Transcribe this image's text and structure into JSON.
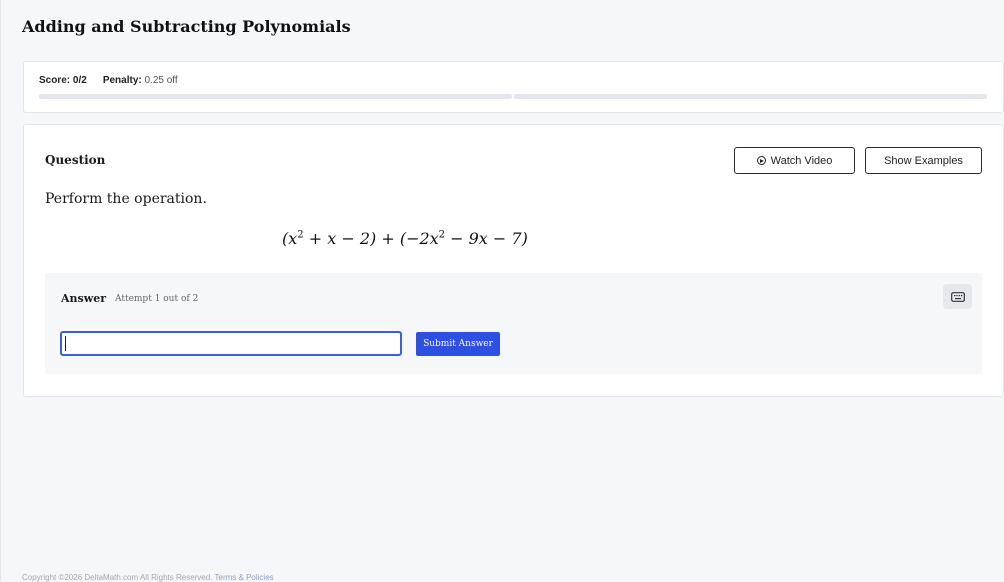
{
  "page": {
    "title": "Adding and Subtracting Polynomials"
  },
  "score": {
    "score_label": "Score:",
    "score_value": "0/2",
    "penalty_label": "Penalty:",
    "penalty_value": "0.25 off",
    "progress_segments": 2
  },
  "question": {
    "label": "Question",
    "watch_video_label": "Watch Video",
    "show_examples_label": "Show Examples",
    "prompt": "Perform the operation.",
    "expression": {
      "part1": "(x",
      "exp1": "2",
      "part2": " + x − 2) + (−2x",
      "exp2": "2",
      "part3": " − 9x − 7)"
    }
  },
  "answer": {
    "label": "Answer",
    "attempt_text": "Attempt 1 out of 2",
    "input_value": "",
    "submit_label": "Submit Answer"
  },
  "footer": {
    "copyright": "Copyright ©2026 DeltaMath.com All Rights Reserved.",
    "terms_link": "Terms & Policies"
  },
  "colors": {
    "accent": "#2f4fe0",
    "input_border": "#3a5fd8",
    "background": "#f6f7f9"
  },
  "icons": {
    "video": "play-circle-icon",
    "keyboard": "keyboard-icon"
  }
}
